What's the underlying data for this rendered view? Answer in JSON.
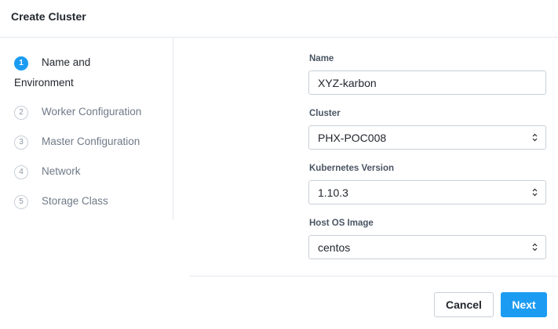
{
  "dialog": {
    "title": "Create Cluster"
  },
  "steps": [
    {
      "number": "1",
      "label": "Name and",
      "label_line2": "Environment",
      "active": true
    },
    {
      "number": "2",
      "label": "Worker Configuration",
      "active": false
    },
    {
      "number": "3",
      "label": "Master Configuration",
      "active": false
    },
    {
      "number": "4",
      "label": "Network",
      "active": false
    },
    {
      "number": "5",
      "label": "Storage Class",
      "active": false
    }
  ],
  "form": {
    "name": {
      "label": "Name",
      "value": "XYZ-karbon"
    },
    "cluster": {
      "label": "Cluster",
      "value": "PHX-POC008"
    },
    "kubernetes_version": {
      "label": "Kubernetes Version",
      "value": "1.10.3"
    },
    "host_os_image": {
      "label": "Host OS Image",
      "value": "centos"
    }
  },
  "footer": {
    "cancel_label": "Cancel",
    "next_label": "Next"
  },
  "colors": {
    "accent": "#1b9cf2",
    "border": "#c9d0d8",
    "divider": "#e3e7ec"
  },
  "icons": {
    "select_arrows": "up-down-chevron-icon"
  }
}
